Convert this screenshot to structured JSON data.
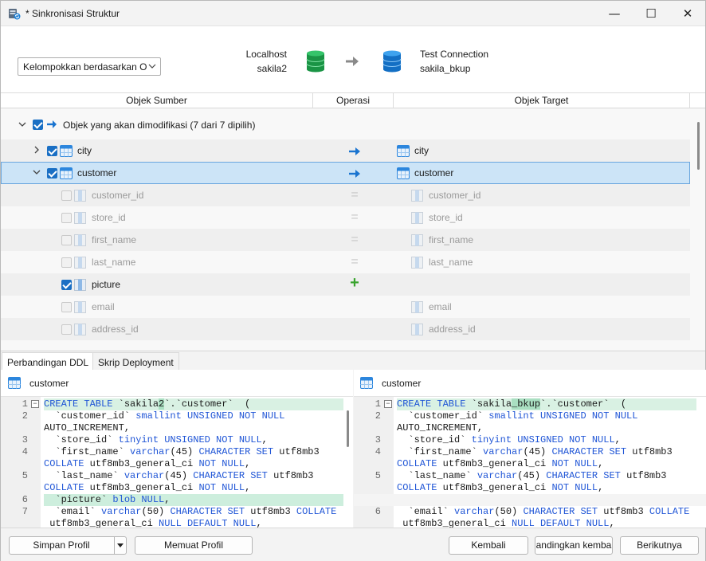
{
  "window": {
    "title": "* Sinkronisasi Struktur",
    "controls": {
      "minimize": "—",
      "maximize": "☐",
      "close": "✕"
    }
  },
  "header": {
    "group_select": "Kelompokkan berdasarkan Op",
    "source": {
      "connection": "Localhost",
      "database": "sakila2",
      "icon": "database-icon",
      "color": "#1fa24a"
    },
    "target": {
      "connection": "Test Connection",
      "database": "sakila_bkup",
      "icon": "database-icon",
      "color": "#1b7fd6"
    }
  },
  "columns": {
    "source": "Objek Sumber",
    "operation": "Operasi",
    "target": "Objek Target"
  },
  "tree": {
    "group_label": "Objek yang akan dimodifikasi (7 dari 7 dipilih)",
    "tables": [
      {
        "name": "city",
        "target": "city",
        "expanded": false,
        "checked": true
      },
      {
        "name": "customer",
        "target": "customer",
        "expanded": true,
        "checked": true
      }
    ],
    "columns": [
      {
        "name": "customer_id",
        "target": "customer_id",
        "op": "=",
        "checked": false
      },
      {
        "name": "store_id",
        "target": "store_id",
        "op": "=",
        "checked": false
      },
      {
        "name": "first_name",
        "target": "first_name",
        "op": "=",
        "checked": false
      },
      {
        "name": "last_name",
        "target": "last_name",
        "op": "=",
        "checked": false
      },
      {
        "name": "picture",
        "target": "",
        "op": "+",
        "checked": true
      },
      {
        "name": "email",
        "target": "email",
        "op": "",
        "checked": false
      },
      {
        "name": "address_id",
        "target": "address_id",
        "op": "",
        "checked": false
      }
    ]
  },
  "tabs": {
    "ddl": "Perbandingan DDL",
    "script": "Skrip Deployment"
  },
  "ddl": {
    "left": {
      "title": "customer",
      "lines": [
        {
          "n": "1",
          "t": "CREATE TABLE `sakila2`.`customer`  ("
        },
        {
          "n": "2",
          "t": "  `customer_id` smallint UNSIGNED NOT NULL"
        },
        {
          "n": "",
          "t": "AUTO_INCREMENT,"
        },
        {
          "n": "3",
          "t": "  `store_id` tinyint UNSIGNED NOT NULL,"
        },
        {
          "n": "4",
          "t": "  `first_name` varchar(45) CHARACTER SET utf8mb3"
        },
        {
          "n": "",
          "t": "COLLATE utf8mb3_general_ci NOT NULL,"
        },
        {
          "n": "5",
          "t": "  `last_name` varchar(45) CHARACTER SET utf8mb3"
        },
        {
          "n": "",
          "t": "COLLATE utf8mb3_general_ci NOT NULL,"
        },
        {
          "n": "6",
          "t": "  `picture` blob NULL,"
        },
        {
          "n": "7",
          "t": "  `email` varchar(50) CHARACTER SET utf8mb3 COLLATE"
        },
        {
          "n": "",
          "t": " utf8mb3_general_ci NULL DEFAULT NULL,"
        }
      ]
    },
    "right": {
      "title": "customer",
      "lines": [
        {
          "n": "1",
          "t": "CREATE TABLE `sakila_bkup`.`customer`  ("
        },
        {
          "n": "2",
          "t": "  `customer_id` smallint UNSIGNED NOT NULL"
        },
        {
          "n": "",
          "t": "AUTO_INCREMENT,"
        },
        {
          "n": "3",
          "t": "  `store_id` tinyint UNSIGNED NOT NULL,"
        },
        {
          "n": "4",
          "t": "  `first_name` varchar(45) CHARACTER SET utf8mb3"
        },
        {
          "n": "",
          "t": "COLLATE utf8mb3_general_ci NOT NULL,"
        },
        {
          "n": "5",
          "t": "  `last_name` varchar(45) CHARACTER SET utf8mb3"
        },
        {
          "n": "",
          "t": "COLLATE utf8mb3_general_ci NOT NULL,"
        },
        {
          "n": "",
          "t": ""
        },
        {
          "n": "6",
          "t": "  `email` varchar(50) CHARACTER SET utf8mb3 COLLATE"
        },
        {
          "n": "",
          "t": " utf8mb3_general_ci NULL DEFAULT NULL,"
        }
      ]
    }
  },
  "footer": {
    "save_profile": "Simpan Profil",
    "load_profile": "Memuat Profil",
    "back": "Kembali",
    "compare_again": "andingkan kemba",
    "next": "Berikutnya"
  }
}
